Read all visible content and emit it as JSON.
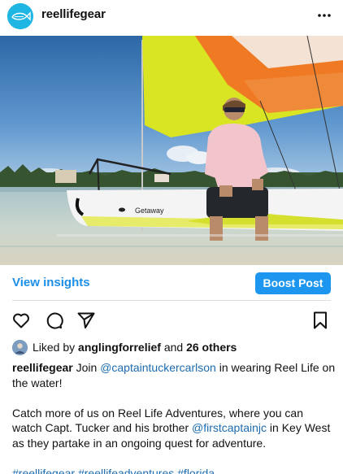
{
  "post": {
    "username": "reellifegear",
    "more_icon": "more-horizontal-icon"
  },
  "photo": {
    "boat_text": "Getaway"
  },
  "insights": {
    "view_label": "View insights",
    "boost_label": "Boost Post"
  },
  "actions": {
    "like_icon": "heart-icon",
    "comment_icon": "comment-icon",
    "share_icon": "send-icon",
    "save_icon": "bookmark-icon"
  },
  "likes": {
    "prefix": "Liked by",
    "user": "anglingforrelief",
    "connector": "and",
    "others": "26 others"
  },
  "caption": {
    "username": "reellifegear",
    "line1_a": "Join",
    "mention1": "@captaintuckercarlson",
    "line1_b": "in wearing Reel Life on the water!",
    "para2_a": "Catch more of us on Reel Life Adventures, where you can watch Capt. Tucker and his brother",
    "mention2": "@firstcaptainjc",
    "para2_b": "in Key West as they partake in an ongoing quest for adventure.",
    "hashtag1": "#reellifegear",
    "hashtag2": "#reellifeadventures",
    "hashtag3": "#florida"
  },
  "colors": {
    "accent_blue": "#1d96f0",
    "link_blue": "#1c6bb0",
    "avatar_blue": "#20b6e3"
  }
}
